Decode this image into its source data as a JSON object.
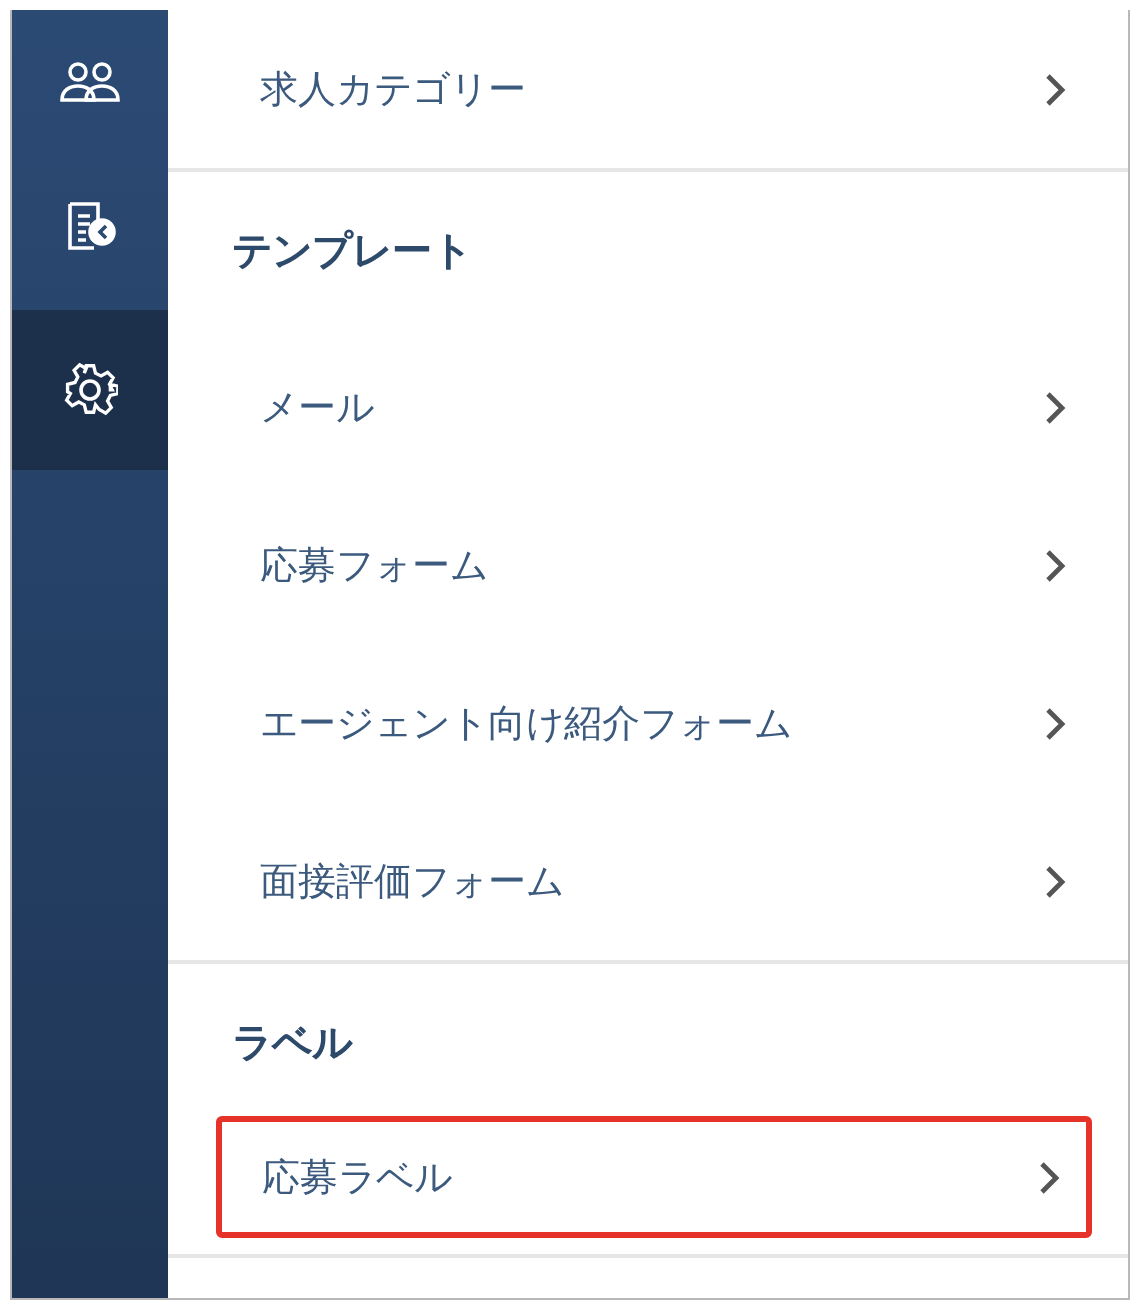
{
  "sidebar": {
    "items": [
      {
        "kind": "people",
        "selected": false
      },
      {
        "kind": "document",
        "selected": false
      },
      {
        "kind": "settings",
        "selected": true
      }
    ]
  },
  "sections": [
    {
      "items": [
        {
          "label": "求人カテゴリー",
          "highlighted": false
        }
      ]
    },
    {
      "title": "テンプレート",
      "items": [
        {
          "label": "メール",
          "highlighted": false
        },
        {
          "label": "応募フォーム",
          "highlighted": false
        },
        {
          "label": "エージェント向け紹介フォーム",
          "highlighted": false
        },
        {
          "label": "面接評価フォーム",
          "highlighted": false
        }
      ]
    },
    {
      "title": "ラベル",
      "items": [
        {
          "label": "応募ラベル",
          "highlighted": true
        }
      ]
    }
  ]
}
